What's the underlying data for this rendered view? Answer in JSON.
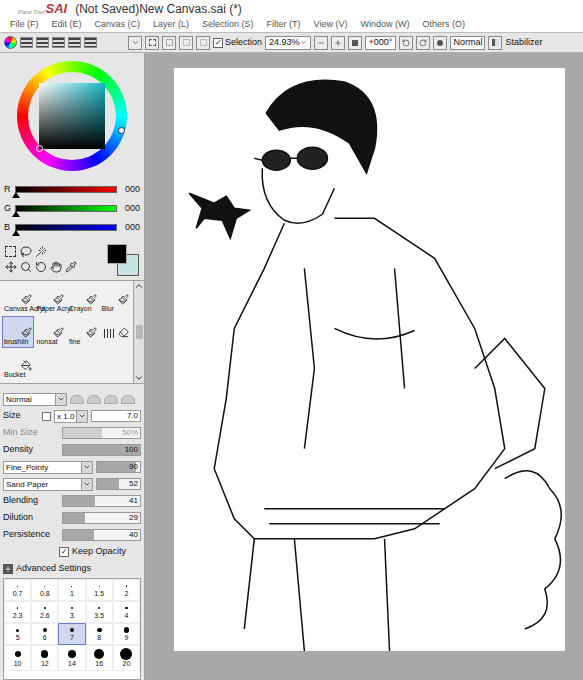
{
  "window": {
    "logo_small": "Paint Tool",
    "logo": "SAI",
    "title": "(Not Saved)New Canvas.sai (*)"
  },
  "menu": [
    "File (F)",
    "Edit (E)",
    "Canvas (C)",
    "Layer (L)",
    "Selection (S)",
    "Filter (T)",
    "View (V)",
    "Window (W)",
    "Others (O)"
  ],
  "toolbar": {
    "selection": {
      "label": "Selection",
      "checked": true
    },
    "zoom": "24.93%",
    "rotation": "+000°",
    "blend_mode": "Normal",
    "stabilizer": "Stabilizer"
  },
  "color": {
    "channels": [
      {
        "name": "R",
        "value": "000",
        "level": 0,
        "color": "#ff0000"
      },
      {
        "name": "G",
        "value": "000",
        "level": 0,
        "color": "#00ff00"
      },
      {
        "name": "B",
        "value": "000",
        "level": 0,
        "color": "#0000ff"
      }
    ],
    "primary": "#000000",
    "secondary": "#c6e4e4"
  },
  "tools": [
    {
      "label": "Canvas Acryl",
      "kind": "brush",
      "selected": false
    },
    {
      "label": "Paper Acryl",
      "kind": "brush",
      "selected": false
    },
    {
      "label": "Crayon",
      "kind": "brush",
      "selected": false
    },
    {
      "label": "Blur",
      "kind": "brush",
      "selected": false
    },
    {
      "label": "brushlin",
      "kind": "brush",
      "selected": true
    },
    {
      "label": "nonsat",
      "kind": "brush",
      "selected": false
    },
    {
      "label": "fine",
      "kind": "brush",
      "selected": false
    },
    {
      "kind": "eraser",
      "selected": false
    },
    {
      "label": "Bucket",
      "kind": "bucket",
      "selected": false
    }
  ],
  "brush": {
    "mode": "Normal",
    "size": {
      "label": "Size",
      "multiplier": "x 1.0",
      "value": "7.0"
    },
    "params": [
      {
        "label": "Min Size",
        "value": "50%",
        "level": 0.5,
        "disabled": true
      },
      {
        "label": "Density",
        "value": "100",
        "level": 1,
        "disabled": false
      }
    ],
    "shape": {
      "name": "Fine_Pointy",
      "value": "90",
      "level": 0.9
    },
    "texture": {
      "name": "Sand Paper",
      "value": "52",
      "level": 0.52
    },
    "mix": [
      {
        "label": "Blending",
        "value": "41",
        "level": 0.41
      },
      {
        "label": "Dilution",
        "value": "29",
        "level": 0.29
      },
      {
        "label": "Persistence",
        "value": "40",
        "level": 0.4
      }
    ],
    "keep_opacity": {
      "label": "Keep Opacity",
      "checked": true
    },
    "advanced": {
      "label": "Advanced Settings"
    }
  },
  "sizes": [
    {
      "label": "0.7",
      "selected": false
    },
    {
      "label": "0.8",
      "selected": false
    },
    {
      "label": "1",
      "selected": false
    },
    {
      "label": "1.5",
      "selected": false
    },
    {
      "label": "2",
      "selected": false
    },
    {
      "label": "2.3",
      "selected": false
    },
    {
      "label": "2.6",
      "selected": false
    },
    {
      "label": "3",
      "selected": false
    },
    {
      "label": "3.5",
      "selected": false
    },
    {
      "label": "4",
      "selected": false
    },
    {
      "label": "5",
      "selected": false
    },
    {
      "label": "6",
      "selected": false
    },
    {
      "label": "7",
      "selected": true
    },
    {
      "label": "8",
      "selected": false
    },
    {
      "label": "9",
      "selected": false
    },
    {
      "label": "10",
      "selected": false
    },
    {
      "label": "12",
      "selected": false
    },
    {
      "label": "14",
      "selected": false
    },
    {
      "label": "16",
      "selected": false
    },
    {
      "label": "20",
      "selected": false
    }
  ]
}
